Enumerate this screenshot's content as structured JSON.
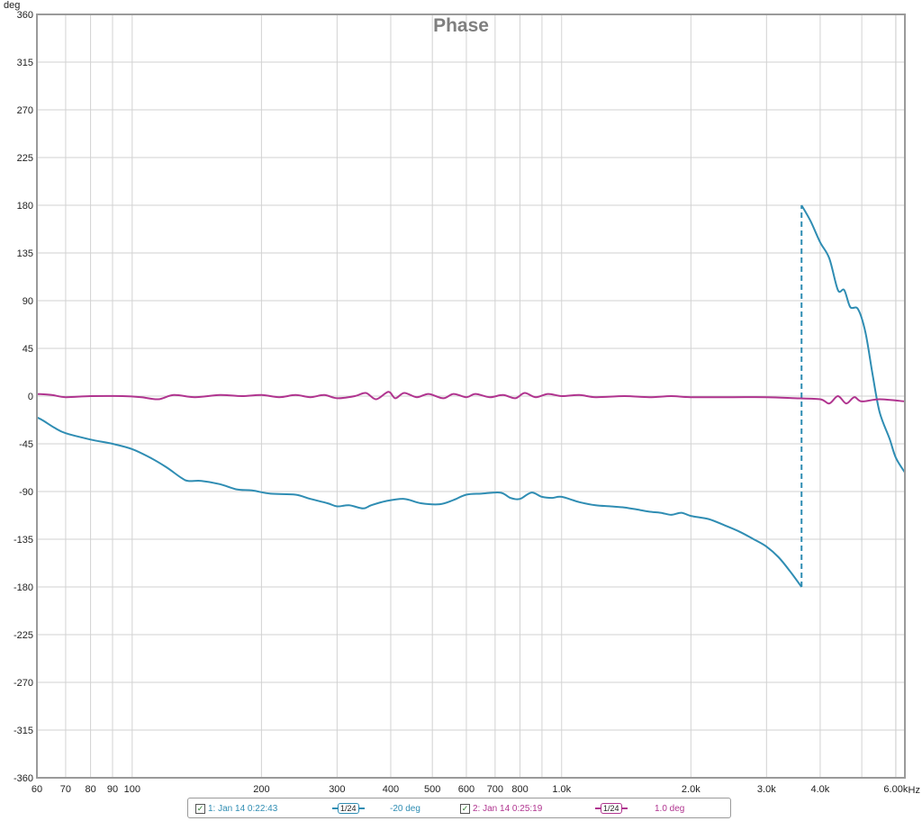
{
  "chart_data": {
    "type": "line",
    "title": "Phase",
    "ylabel": "deg",
    "xunit": "Hz",
    "xscale": "log",
    "xlim": [
      60,
      6300
    ],
    "ylim": [
      -360,
      360
    ],
    "grid": true,
    "y_ticks": [
      360,
      315,
      270,
      225,
      180,
      135,
      90,
      45,
      0,
      -45,
      -90,
      -135,
      -180,
      -225,
      -270,
      -315,
      -360
    ],
    "x_ticks": [
      {
        "value": 60,
        "label": "60"
      },
      {
        "value": 70,
        "label": "70"
      },
      {
        "value": 80,
        "label": "80"
      },
      {
        "value": 90,
        "label": "90"
      },
      {
        "value": 100,
        "label": "100"
      },
      {
        "value": 200,
        "label": "200"
      },
      {
        "value": 300,
        "label": "300"
      },
      {
        "value": 400,
        "label": "400"
      },
      {
        "value": 500,
        "label": "500"
      },
      {
        "value": 600,
        "label": "600"
      },
      {
        "value": 700,
        "label": "700"
      },
      {
        "value": 800,
        "label": "800"
      },
      {
        "value": 1000,
        "label": "1.0k"
      },
      {
        "value": 2000,
        "label": "2.0k"
      },
      {
        "value": 3000,
        "label": "3.0k"
      },
      {
        "value": 4000,
        "label": "4.0k"
      },
      {
        "value": 6000,
        "label": "6.00k"
      }
    ],
    "x_minor_grid": [
      900,
      5000,
      6000
    ],
    "series": [
      {
        "name": "1: Jan 14 0:22:43",
        "color": "#2f8db3",
        "smoothing": "1/24",
        "offset": "-20 deg",
        "wrap_at_hz": 3620,
        "points": [
          [
            60,
            -20
          ],
          [
            62,
            -23
          ],
          [
            66,
            -30
          ],
          [
            70,
            -35
          ],
          [
            80,
            -41
          ],
          [
            90,
            -45
          ],
          [
            100,
            -50
          ],
          [
            110,
            -58
          ],
          [
            120,
            -67
          ],
          [
            130,
            -77
          ],
          [
            135,
            -80
          ],
          [
            145,
            -80
          ],
          [
            160,
            -83
          ],
          [
            175,
            -88
          ],
          [
            190,
            -89
          ],
          [
            210,
            -92
          ],
          [
            240,
            -93
          ],
          [
            260,
            -97
          ],
          [
            285,
            -101
          ],
          [
            300,
            -104
          ],
          [
            320,
            -103
          ],
          [
            345,
            -106
          ],
          [
            360,
            -103
          ],
          [
            390,
            -99
          ],
          [
            430,
            -97
          ],
          [
            470,
            -101
          ],
          [
            520,
            -102
          ],
          [
            560,
            -98
          ],
          [
            600,
            -93
          ],
          [
            650,
            -92
          ],
          [
            720,
            -91
          ],
          [
            760,
            -96
          ],
          [
            800,
            -97
          ],
          [
            850,
            -91
          ],
          [
            900,
            -95
          ],
          [
            950,
            -96
          ],
          [
            1000,
            -95
          ],
          [
            1100,
            -100
          ],
          [
            1200,
            -103
          ],
          [
            1300,
            -104
          ],
          [
            1400,
            -105
          ],
          [
            1500,
            -107
          ],
          [
            1600,
            -109
          ],
          [
            1700,
            -110
          ],
          [
            1800,
            -112
          ],
          [
            1900,
            -110
          ],
          [
            2000,
            -113
          ],
          [
            2200,
            -116
          ],
          [
            2400,
            -122
          ],
          [
            2600,
            -128
          ],
          [
            2800,
            -135
          ],
          [
            3000,
            -142
          ],
          [
            3200,
            -152
          ],
          [
            3400,
            -165
          ],
          [
            3620,
            -180
          ],
          [
            3620,
            180
          ],
          [
            3800,
            165
          ],
          [
            4000,
            145
          ],
          [
            4200,
            130
          ],
          [
            4400,
            100
          ],
          [
            4550,
            100
          ],
          [
            4700,
            84
          ],
          [
            4900,
            82
          ],
          [
            5100,
            60
          ],
          [
            5300,
            20
          ],
          [
            5500,
            -15
          ],
          [
            5800,
            -40
          ],
          [
            6000,
            -58
          ],
          [
            6300,
            -72
          ]
        ]
      },
      {
        "name": "2: Jan 14 0:25:19",
        "color": "#b0348f",
        "smoothing": "1/24",
        "offset": "1.0 deg",
        "points": [
          [
            60,
            2
          ],
          [
            65,
            1
          ],
          [
            70,
            -1
          ],
          [
            80,
            0
          ],
          [
            95,
            0
          ],
          [
            105,
            -1
          ],
          [
            115,
            -3
          ],
          [
            125,
            1
          ],
          [
            140,
            -1
          ],
          [
            160,
            1
          ],
          [
            180,
            0
          ],
          [
            200,
            1
          ],
          [
            220,
            -1
          ],
          [
            240,
            1
          ],
          [
            260,
            -1
          ],
          [
            280,
            1
          ],
          [
            300,
            -2
          ],
          [
            330,
            0
          ],
          [
            350,
            3
          ],
          [
            370,
            -3
          ],
          [
            395,
            4
          ],
          [
            410,
            -2
          ],
          [
            430,
            3
          ],
          [
            460,
            -1
          ],
          [
            490,
            2
          ],
          [
            530,
            -2
          ],
          [
            560,
            2
          ],
          [
            600,
            -1
          ],
          [
            630,
            2
          ],
          [
            680,
            -1
          ],
          [
            730,
            1
          ],
          [
            780,
            -2
          ],
          [
            820,
            3
          ],
          [
            870,
            -1
          ],
          [
            930,
            2
          ],
          [
            1000,
            0
          ],
          [
            1100,
            1
          ],
          [
            1200,
            -1
          ],
          [
            1400,
            0
          ],
          [
            1600,
            -1
          ],
          [
            1800,
            0
          ],
          [
            2000,
            -1
          ],
          [
            2500,
            -1
          ],
          [
            3000,
            -1
          ],
          [
            3500,
            -2
          ],
          [
            4000,
            -3
          ],
          [
            4200,
            -7
          ],
          [
            4400,
            0
          ],
          [
            4600,
            -7
          ],
          [
            4800,
            -1
          ],
          [
            5000,
            -5
          ],
          [
            5500,
            -3
          ],
          [
            6300,
            -5
          ]
        ]
      }
    ]
  },
  "legend": {
    "series1_label": "1: Jan 14 0:22:43",
    "series1_smoothing": "1/24",
    "series1_offset": "-20 deg",
    "series2_label": "2: Jan 14 0:25:19",
    "series2_smoothing": "1/24",
    "series2_offset": "1.0 deg"
  }
}
